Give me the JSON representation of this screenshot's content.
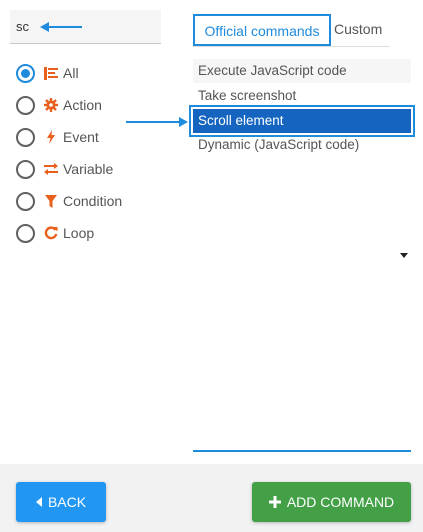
{
  "search": {
    "value": "sc"
  },
  "filters": [
    {
      "label": "All",
      "icon": "list-icon",
      "checked": true
    },
    {
      "label": "Action",
      "icon": "gear-icon",
      "checked": false
    },
    {
      "label": "Event",
      "icon": "bolt-icon",
      "checked": false
    },
    {
      "label": "Variable",
      "icon": "exchange-icon",
      "checked": false
    },
    {
      "label": "Condition",
      "icon": "filter-icon",
      "checked": false
    },
    {
      "label": "Loop",
      "icon": "refresh-icon",
      "checked": false
    }
  ],
  "tabs": {
    "official": "Official commands",
    "custom": "Custom"
  },
  "commands": [
    {
      "label": "Execute JavaScript code"
    },
    {
      "label": "Take screenshot"
    },
    {
      "label": "Scroll element"
    },
    {
      "label": "Dynamic (JavaScript code)"
    }
  ],
  "footer": {
    "back_label": "BACK",
    "add_label": "ADD COMMAND"
  },
  "colors": {
    "accent": "#1f8bdc",
    "icon_orange": "#e8601c",
    "selected_bg": "#1565c0",
    "back_btn": "#2196f3",
    "add_btn": "#43a047"
  }
}
